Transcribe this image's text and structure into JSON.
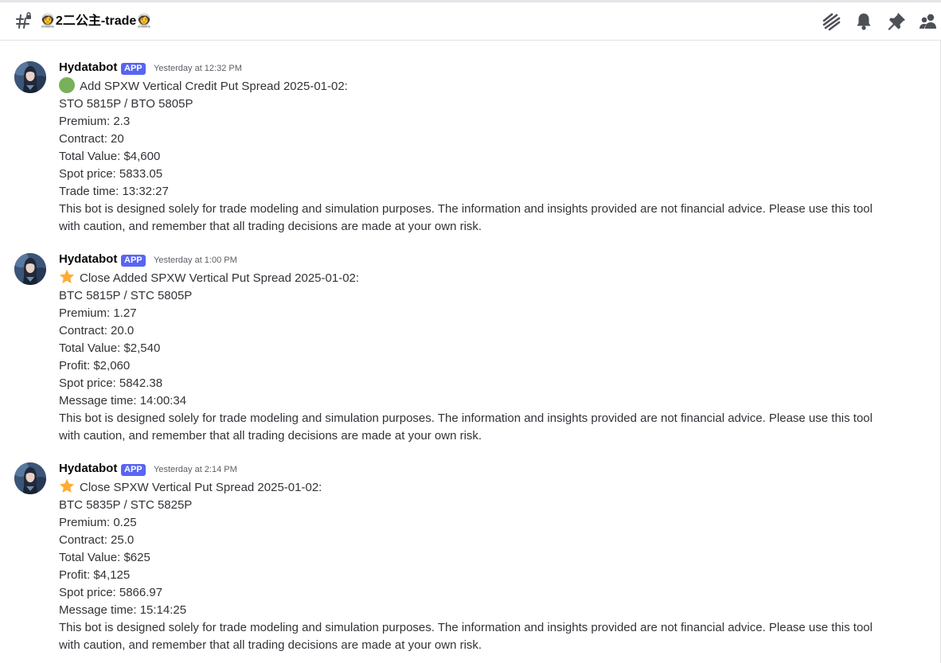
{
  "channel": {
    "name": "👩‍🚀2二公主-trade👩‍🚀"
  },
  "header_icons": [
    "threads-icon",
    "notification-bell-icon",
    "pin-icon",
    "member-list-icon"
  ],
  "messages": [
    {
      "author": "Hydatabot",
      "badge": "APP",
      "timestamp": "Yesterday at 12:32 PM",
      "emoji": "green-circle-icon",
      "title": "Add SPXW Vertical Credit Put Spread 2025-01-02:",
      "lines": [
        "STO 5815P / BTO 5805P",
        "Premium: 2.3",
        "Contract: 20",
        "Total Value: $4,600",
        "Spot price: 5833.05",
        "Trade time: 13:32:27"
      ],
      "disclaimer": "This bot is designed solely for trade modeling and simulation purposes. The information and insights provided are not financial advice. Please use this tool with caution, and remember that all trading decisions are made at your own risk."
    },
    {
      "author": "Hydatabot",
      "badge": "APP",
      "timestamp": "Yesterday at 1:00 PM",
      "emoji": "star-icon",
      "title": "Close Added SPXW Vertical Put Spread 2025-01-02:",
      "lines": [
        "BTC 5815P / STC 5805P",
        "Premium: 1.27",
        "Contract: 20.0",
        "Total Value: $2,540",
        "Profit: $2,060",
        "Spot price: 5842.38",
        "Message time: 14:00:34"
      ],
      "disclaimer": "This bot is designed solely for trade modeling and simulation purposes. The information and insights provided are not financial advice. Please use this tool with caution, and remember that all trading decisions are made at your own risk."
    },
    {
      "author": "Hydatabot",
      "badge": "APP",
      "timestamp": "Yesterday at 2:14 PM",
      "emoji": "star-icon",
      "title": "Close SPXW Vertical Put Spread 2025-01-02:",
      "lines": [
        "BTC 5835P / STC 5825P",
        "Premium: 0.25",
        "Contract: 25.0",
        "Total Value: $625",
        "Profit: $4,125",
        "Spot price: 5866.97",
        "Message time: 15:14:25"
      ],
      "disclaimer": "This bot is designed solely for trade modeling and simulation purposes. The information and insights provided are not financial advice. Please use this tool with caution, and remember that all trading decisions are made at your own risk."
    }
  ],
  "colors": {
    "badge": "#5865f2",
    "text": "#313338",
    "username": "#060607",
    "timestamp": "#5c5e66"
  }
}
